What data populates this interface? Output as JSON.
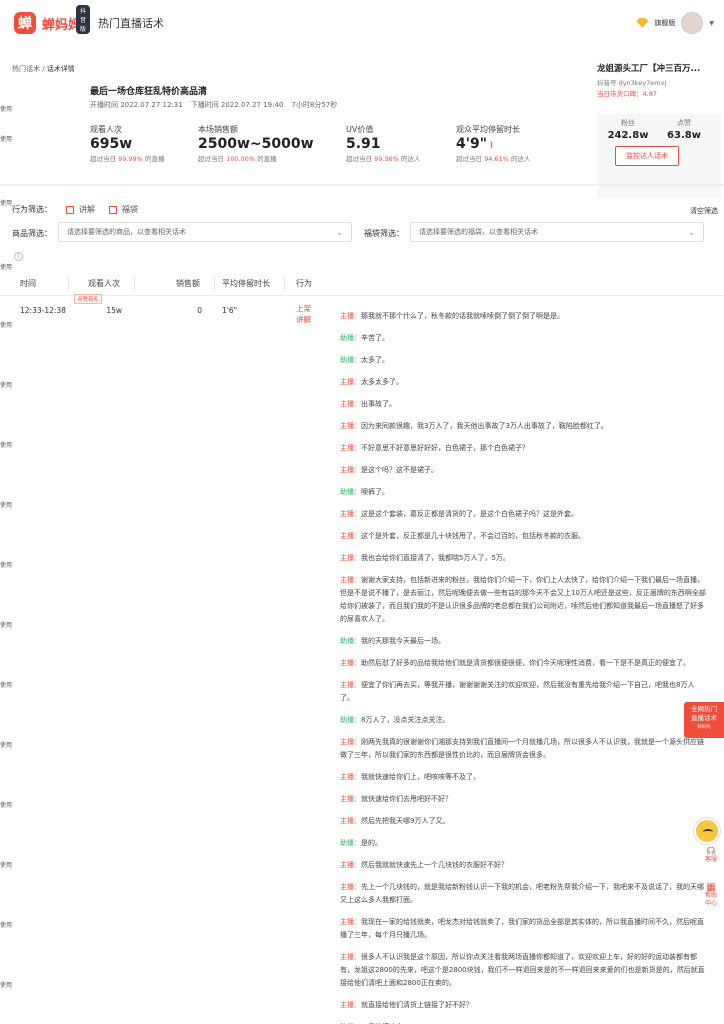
{
  "app": {
    "logo_mark": "蝉",
    "logo_text": "蝉妈妈",
    "logo_badge": "抖音版",
    "page_name": "热门直播话术",
    "vip_label": "旗舰版"
  },
  "left_tags": [
    "使用",
    "使用",
    "使用",
    "使用",
    "使用",
    "使用",
    "使用",
    "使用",
    "使用",
    "使用",
    "使用",
    "使用",
    "使用",
    "使用",
    "使用",
    "使用"
  ],
  "breadcrumb": {
    "parent": "热门话术",
    "sep": " / ",
    "current": "话术详情"
  },
  "live": {
    "title": "最后一场仓库狂乱特价高品清",
    "start": "开播时间 2022.07.27 12:31",
    "end": "下播时间 2022.07.27 19:40",
    "duration": "7小时8分57秒"
  },
  "metrics": [
    {
      "label": "观看人次",
      "value": "695w",
      "sub_pre": "超过当日 ",
      "sub_hl": "99.99%",
      "sub_post": " 的直播"
    },
    {
      "label": "本场销售额",
      "value": "2500w~5000w",
      "sub_pre": "超过当日 ",
      "sub_hl": "100.00%",
      "sub_post": " 的直播"
    },
    {
      "label": "UV价值",
      "value": "5.91",
      "sub_pre": "超过当日 ",
      "sub_hl": "99.36%",
      "sub_post": " 的达人"
    },
    {
      "label": "观众平均停留时长",
      "value": "4'9\"",
      "sub_pre": "超过当日 ",
      "sub_hl": "94.61%",
      "sub_post": " 的达人"
    }
  ],
  "host": {
    "name": "龙姐源头工厂【冲三百万...",
    "douyin_id": "抖音号 dyn3key7emvj",
    "rank": "当日带货口碑：4.87",
    "fans_label": "粉丝",
    "fans": "242.8w",
    "likes_label": "点赞",
    "likes": "63.8w",
    "monitor_button": "监控达人话术"
  },
  "filters": {
    "behavior_label": "行为筛选：",
    "options": [
      "讲解",
      "福袋"
    ],
    "clear": "清空筛选",
    "product_label": "商品筛选：",
    "product_placeholder": "请选择要筛选的商品，以查看相关话术",
    "bag_label": "福袋筛选：",
    "bag_placeholder": "请选择要筛选的福袋，以查看相关话术"
  },
  "table": {
    "headers": [
      "时间",
      "观看人次",
      "销售额",
      "平均停留时长",
      "行为"
    ],
    "row": {
      "time": "12:33-12:38",
      "peak_badge": "点赞有礼",
      "viewers": "15w",
      "sales": "0",
      "stay": "1'6\"",
      "action_1": "上架",
      "action_2": "讲解"
    }
  },
  "transcript": [
    {
      "role": "主播：",
      "type": "host",
      "text": "那我就不那个什么了，秋冬款的话我就嗦嗦倒了倒了倒了啊是是。"
    },
    {
      "role": "助播：",
      "type": "assist",
      "text": "辛苦了。"
    },
    {
      "role": "助播：",
      "type": "assist",
      "text": "太多了。"
    },
    {
      "role": "主播：",
      "type": "host",
      "text": "太多太多了。"
    },
    {
      "role": "主播：",
      "type": "host",
      "text": "出事故了。"
    },
    {
      "role": "主播：",
      "type": "host",
      "text": "因为来同款很趣，我3万人了，我天他出事故了3万人出事故了，鞍陷脸都红了。"
    },
    {
      "role": "主播：",
      "type": "host",
      "text": "不好意思不好意思好好好，白色裙子，那个白色裙子？"
    },
    {
      "role": "主播：",
      "type": "host",
      "text": "是这个吗？这不是裙子。"
    },
    {
      "role": "助播：",
      "type": "assist",
      "text": "噢裤了。"
    },
    {
      "role": "主播：",
      "type": "host",
      "text": "这是这个套装，葛反正都是清货的了，是这个白色裙子吗？这是外套。"
    },
    {
      "role": "主播：",
      "type": "host",
      "text": "这个是外套，反正都是几十块钱甩了，不会过百的，包括秋冬款的衣服。"
    },
    {
      "role": "主播：",
      "type": "host",
      "text": "我也会给你们直接清了，我都喘5万人了，5万。"
    },
    {
      "role": "主播：",
      "type": "host",
      "text": "谢谢大家支持，包括新进来的粉丝，我给你们介绍一下，你们上人太快了，给你们介绍一下我们最后一场直播，但是不是说不播了，是去丽江，然后呢晚便去做一些有益的那今天不会又上10万人吧还是这些，反正届牌的东西啊全部给你们被装了，而且我们我的不是认识很多品牌的老总都在我们公司附近，嗦然后他们都知道我最后一场直播怒了好多的尿喜欢人了。"
    },
    {
      "role": "助播：",
      "type": "assist",
      "text": "我的天那我今天最后一场。"
    },
    {
      "role": "主播：",
      "type": "host",
      "text": "助然后怼了好多的品给我给他们就是清货都很便很便，你们今天呢理性消费，看一下是不是真正的便宜了。"
    },
    {
      "role": "主播：",
      "type": "host",
      "text": "便宜了你们再去买，等我开播，谢谢谢谢关注的欢迎欢迎，然后我没有重先给我介绍一下自己，吧我也8万人了。"
    },
    {
      "role": "助播：",
      "type": "assist",
      "text": "8万人了，没点关注点关注。"
    },
    {
      "role": "主播：",
      "type": "host",
      "text": "刚两先我真的很谢谢你们湘那支持到我们直播间一个月就播几场，所以很多人不认识我，我就是一个源头供应链做了三年，所以我们家的东西都是很性价比的，而且届牌货会很多。"
    },
    {
      "role": "主播：",
      "type": "host",
      "text": "我就快速给你们上，吧咳咳等不及了，"
    },
    {
      "role": "主播：",
      "type": "host",
      "text": "就快速给你们去甩吧好不好？"
    },
    {
      "role": "主播：",
      "type": "host",
      "text": "然后先把我天哪9万人了又。"
    },
    {
      "role": "助播：",
      "type": "assist",
      "text": "是的。"
    },
    {
      "role": "主播：",
      "type": "host",
      "text": "然后我就就快速先上一个几块钱的衣服好不好？"
    },
    {
      "role": "主播：",
      "type": "host",
      "text": "先上一个几块钱的，就是我给新粉钱认识一下我的机会，吧老粉先帮我介绍一下，我吧来不及说话了，我的天哪又上这么多人我都打面。"
    },
    {
      "role": "主播：",
      "type": "host",
      "text": "我现在一家的给钱就卖，吧龙杰对给钱就卖了，我们家的货品全部是其实体的，所以我直播时间不久，然后呢直播了三年，每个月只播几场。"
    },
    {
      "role": "主播：",
      "type": "host",
      "text": "很多人不认识我是这个原因，所以你点关注看我两场直播你都知道了，欢迎欢迎上车，好的好的运动装都有都有，龙姐这2800的先来，吧这个是2800块钱，我们不一样退回来是的不一样退回来来爱的们也是新货是的，然后就直接给他们清吧上面和2800正在卖的。"
    },
    {
      "role": "主播：",
      "type": "host",
      "text": "就直接给他们清货上链接了好不好？"
    },
    {
      "role": "助播：",
      "type": "assist",
      "text": "一号链接这个。"
    }
  ],
  "side": {
    "promo_line1": "全网热门",
    "promo_line2": "直播话术",
    "promo_sub": "蝉妈妈",
    "tool1": "客服",
    "tool2_line1": "帮助",
    "tool2_line2": "中心"
  },
  "colors": {
    "accent": "#ef4e3a",
    "assist": "#31b36a"
  }
}
